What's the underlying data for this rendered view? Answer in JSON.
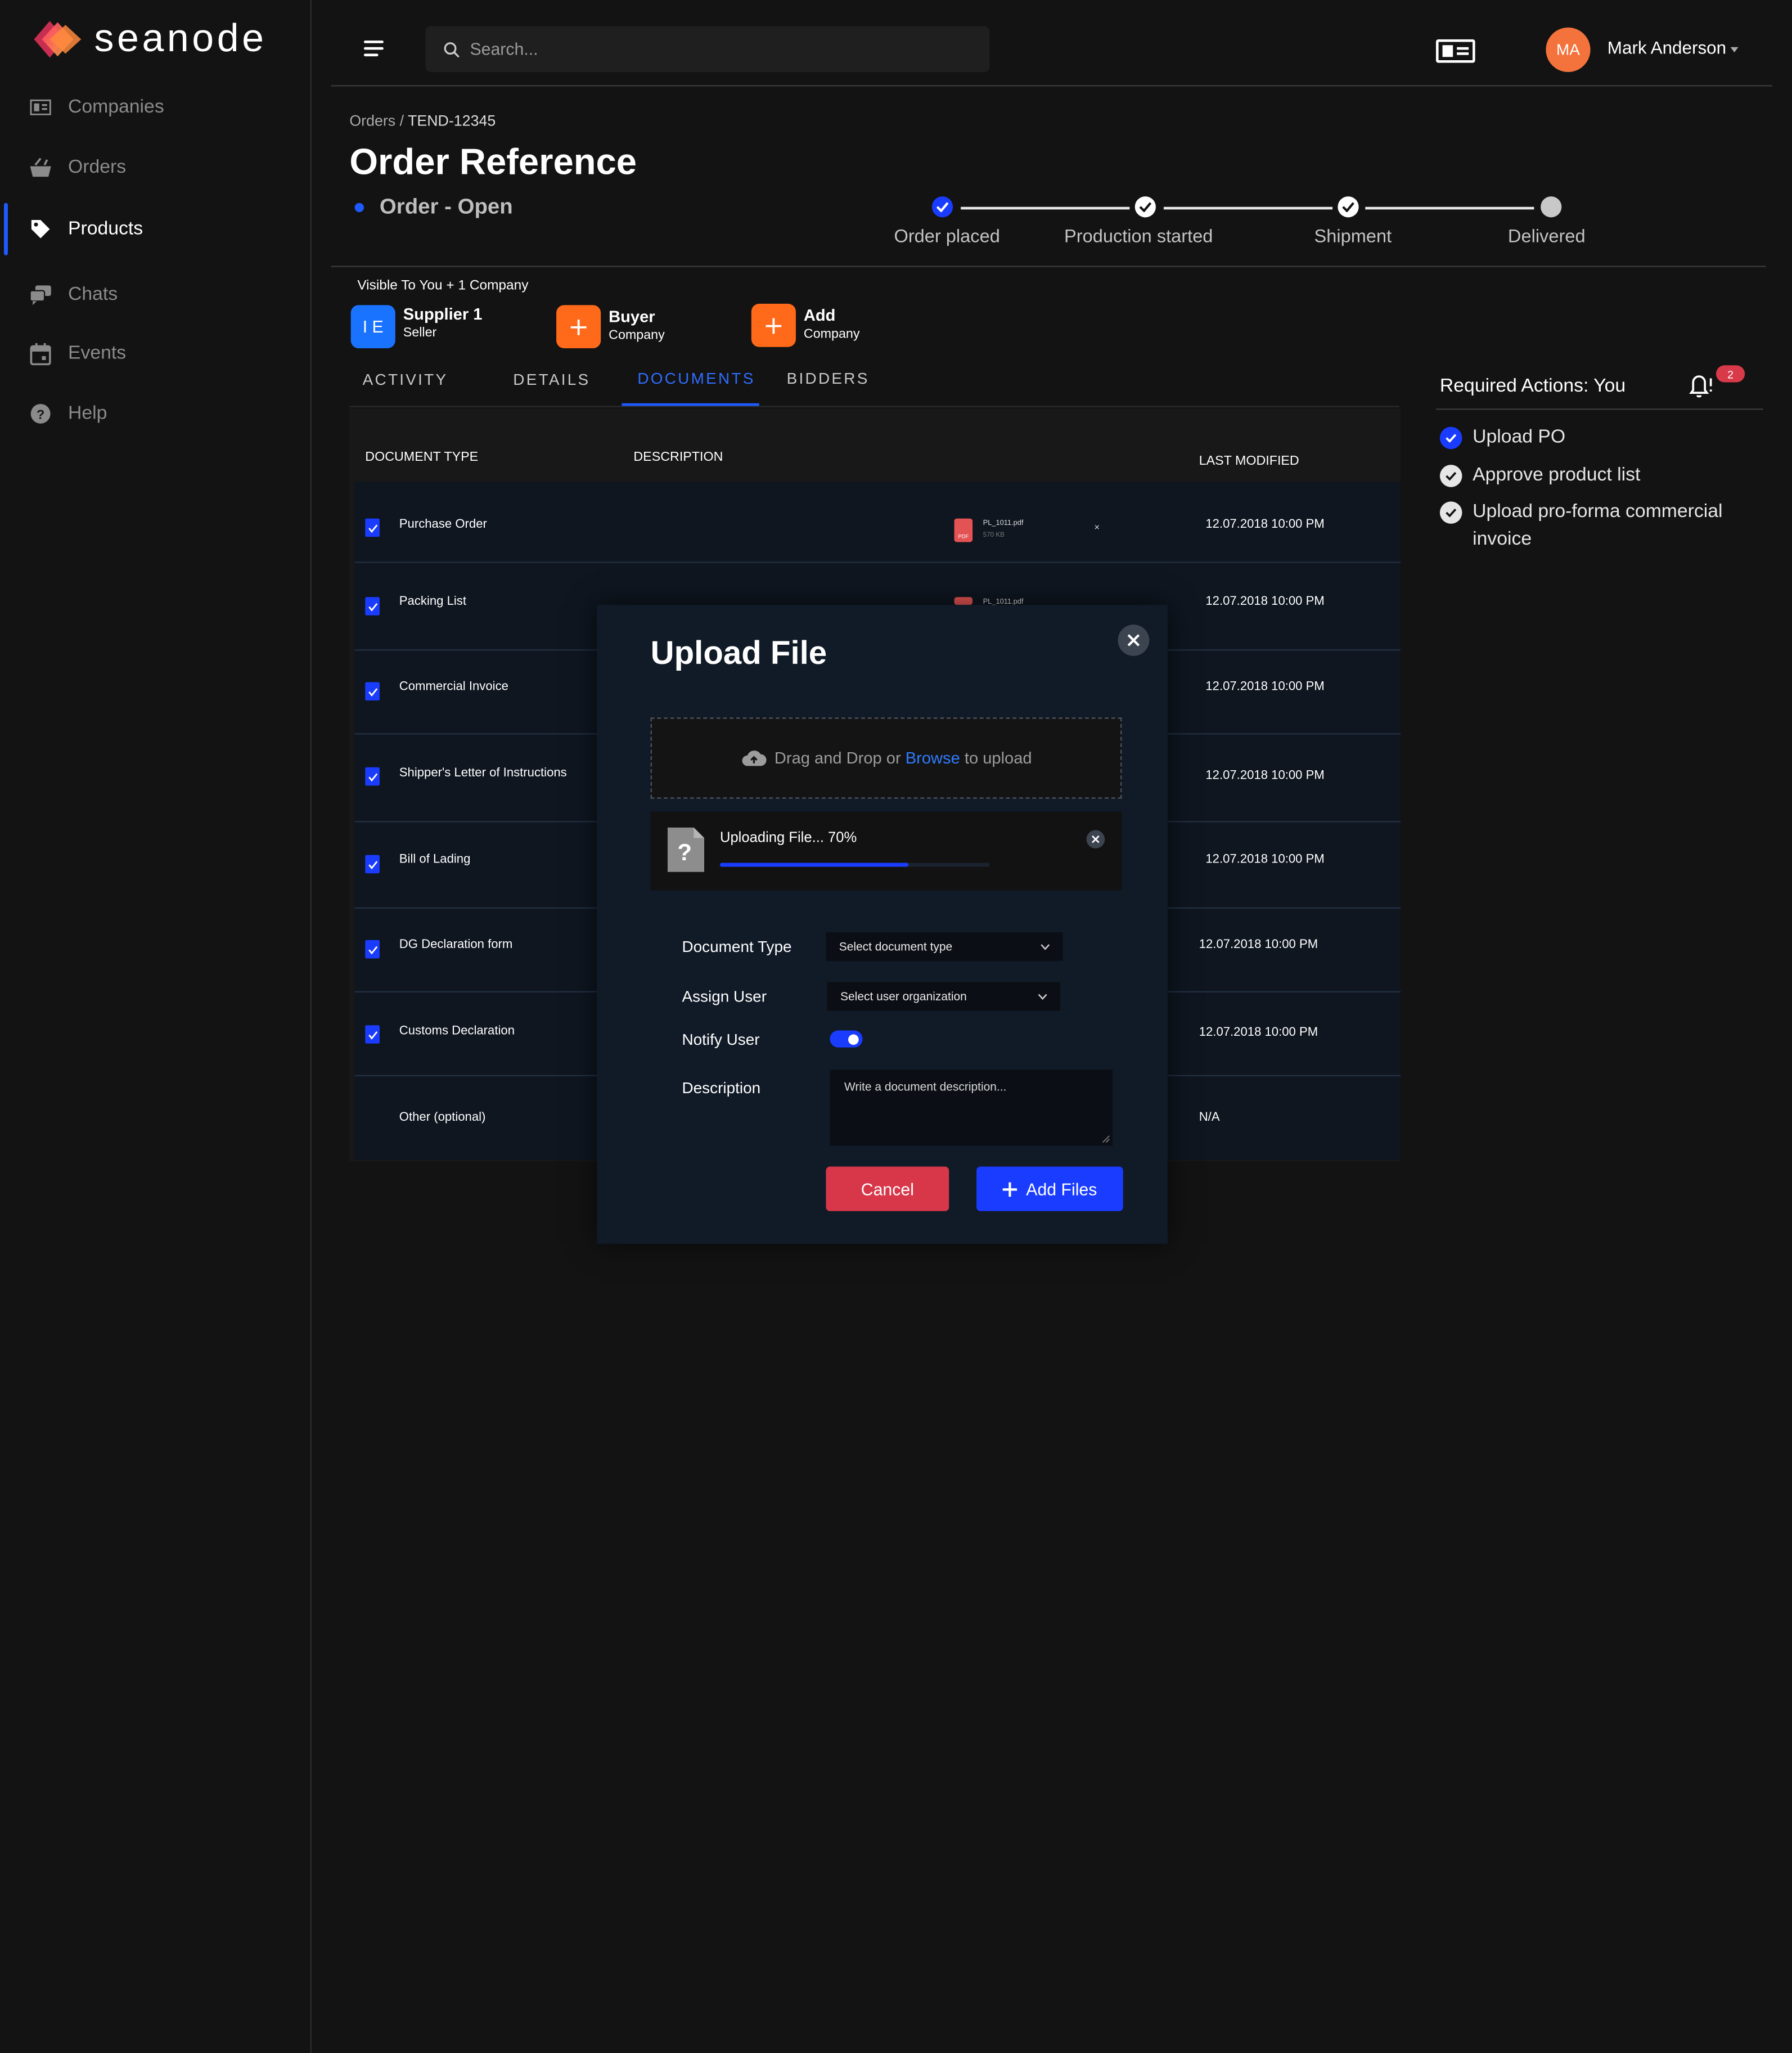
{
  "app": {
    "name": "seanode"
  },
  "sidebar": {
    "items": [
      {
        "label": "Companies",
        "icon": "id-card-icon"
      },
      {
        "label": "Orders",
        "icon": "cart-icon"
      },
      {
        "label": "Products",
        "icon": "tag-icon"
      },
      {
        "label": "Chats",
        "icon": "chat-icon"
      },
      {
        "label": "Events",
        "icon": "calendar-icon"
      },
      {
        "label": "Help",
        "icon": "help-icon"
      }
    ],
    "active": "Products"
  },
  "header": {
    "search_placeholder": "Search...",
    "user": {
      "initials": "MA",
      "name": "Mark Anderson"
    }
  },
  "page": {
    "breadcrumb": {
      "parent": "Orders /",
      "current": "TEND-12345"
    },
    "title": "Order Reference",
    "status": "Order  - Open"
  },
  "stepper": {
    "steps": [
      {
        "label": "Order  placed",
        "state": "current"
      },
      {
        "label": "Production started",
        "state": "done"
      },
      {
        "label": "Shipment",
        "state": "done"
      },
      {
        "label": "Delivered",
        "state": "pending"
      }
    ]
  },
  "companies": {
    "visible_to": "Visible To You + 1 Company",
    "list": [
      {
        "badge": "I E",
        "name": "Supplier 1",
        "role": "Seller",
        "color": "#1a73ff"
      },
      {
        "badge": "+",
        "name": "Buyer",
        "role": "Company",
        "color": "#ff6a1a"
      },
      {
        "badge": "+",
        "name": "Add",
        "role": "Company",
        "color": "#ff6a1a"
      }
    ]
  },
  "tabs": [
    "ACTIVITY",
    "DETAILS",
    "DOCUMENTS",
    "BIDDERS"
  ],
  "active_tab": "DOCUMENTS",
  "table": {
    "headers": {
      "type": "DOCUMENT TYPE",
      "description": "DESCRIPTION",
      "modified": "LAST MODIFIED"
    },
    "rows": [
      {
        "type": "Purchase Order",
        "checked": true,
        "date": "12.07.2018 10:00 PM",
        "file": {
          "name": "PL_1011.pdf",
          "size": "570 KB",
          "badge": "PDF",
          "remove": "×"
        }
      },
      {
        "type": "Packing List",
        "checked": true,
        "date": "12.07.2018 10:00 PM",
        "file": {
          "name": "PL_1011.pdf"
        }
      },
      {
        "type": "Commercial Invoice",
        "checked": true,
        "date": "12.07.2018 10:00 PM"
      },
      {
        "type": "Shipper's Letter of Instructions",
        "checked": true,
        "date": "12.07.2018 10:00 PM"
      },
      {
        "type": "Bill of Lading",
        "checked": true,
        "date": "12.07.2018 10:00 PM"
      },
      {
        "type": "DG Declaration form",
        "checked": true,
        "date": "12.07.2018 10:00 PM"
      },
      {
        "type": "Customs Declaration",
        "checked": true,
        "date": "12.07.2018 10:00 PM"
      },
      {
        "type": "Other (optional)",
        "checked": false,
        "date": "N/A"
      }
    ]
  },
  "required_actions": {
    "title": "Required Actions: You",
    "badge_count": "2",
    "items": [
      {
        "label": "Upload PO",
        "done": true
      },
      {
        "label": "Approve product list",
        "done": false
      },
      {
        "label": "Upload pro-forma commercial invoice",
        "done": false
      }
    ]
  },
  "modal": {
    "title": "Upload File",
    "dropzone": {
      "prefix": "Drag and Drop or ",
      "link": "Browse",
      "suffix": " to upload"
    },
    "upload": {
      "text": "Uploading File... 70%",
      "progress": 70,
      "file_glyph": "?"
    },
    "form": {
      "document_type_label": "Document Type",
      "document_type_value": "Select document type",
      "assign_user_label": "Assign User",
      "assign_user_value": "Select user organization",
      "notify_user_label": "Notify User",
      "notify_user_on": true,
      "description_label": "Description",
      "description_placeholder": "Write a document description..."
    },
    "cancel_label": "Cancel",
    "add_label": "Add Files"
  },
  "colors": {
    "accent": "#1a3cff",
    "danger": "#d8374a",
    "avatar": "#f4733c",
    "orange": "#ff6a1a"
  }
}
